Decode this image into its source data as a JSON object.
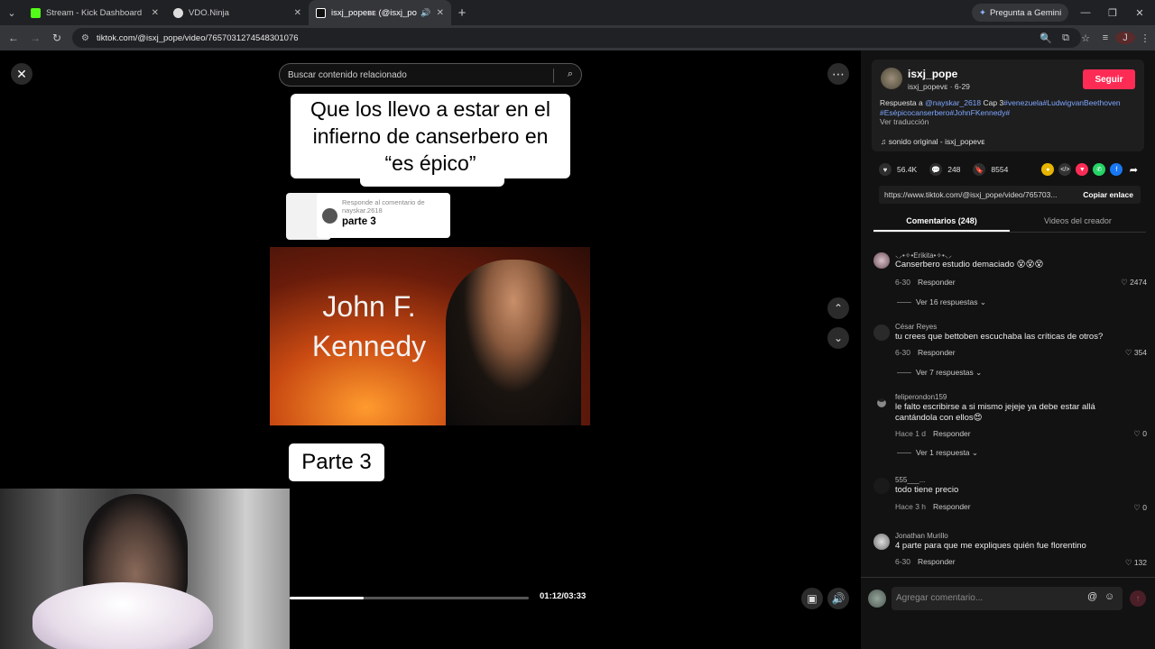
{
  "browser": {
    "tabs": [
      {
        "title": "Stream - Kick Dashboard",
        "favicon_color": "#53fc18"
      },
      {
        "title": "VDO.Ninja",
        "favicon_color": "#dddddd"
      },
      {
        "title": "isxj_popeʙᴇ (@isxj_pope) | T",
        "favicon_color": "#ffffff"
      }
    ],
    "gemini_label": "Pregunta a Gemini",
    "url": "tiktok.com/@isxj_pope/video/7657031274548301076",
    "profile_initial": "J"
  },
  "video": {
    "search_placeholder": "Buscar contenido relacionado",
    "caption": "Que los llevo a estar en el infierno de canserbero en “es épico”",
    "reply_card_header": "Responde al comentario de nayskar.2618",
    "reply_card_text": "parte 3",
    "image_text": "John F. Kennedy",
    "overlay_text": "Parte 3",
    "progress": 0.31,
    "time": "01:12/03:33"
  },
  "panel": {
    "username": "isxj_pope",
    "user_sub": "isxj_popeᴠᴇ · 6-29",
    "follow_label": "Seguir",
    "desc_prefix": "Respuesta a ",
    "desc_mention": "@nayskar_2618",
    "desc_mid": " Cap 3",
    "desc_tags1": "#venezuela#LudwigvanBeethoven",
    "desc_tags2": "#Esépicocanserbero#JohnFKennedy#",
    "see_translation": "Ver traducción",
    "sound": "sonido original - isxj_popeᴠᴇ",
    "likes": "56.4K",
    "comments_count": "248",
    "saves": "8554",
    "link": "https://www.tiktok.com/@isxj_pope/video/765703...",
    "copy_label": "Copiar enlace",
    "tab_comments": "Comentarios (248)",
    "tab_videos": "Videos del creador",
    "comments": [
      {
        "user": "⸜⸝•✧•Erikita•✧•⸜⸝",
        "text": "Canserbero estudio demaciado 😵😵😵",
        "date": "6-30",
        "reply": "Responder",
        "likes": "2474",
        "more": "Ver 16 respuestas"
      },
      {
        "user": "César Reyes",
        "text": "tu crees que bettoben escuchaba las críticas de otros?",
        "date": "6-30",
        "reply": "Responder",
        "likes": "354",
        "more": "Ver 7 respuestas"
      },
      {
        "user": "feliperondon159",
        "text": "le falto escribirse a si mismo jejeje ya debe estar allá cantándola con ellos😍",
        "date": "Hace 1 d",
        "reply": "Responder",
        "likes": "0",
        "more": "Ver 1 respuesta"
      },
      {
        "user": "555___...",
        "text": "todo tiene precio",
        "date": "Hace 3 h",
        "reply": "Responder",
        "likes": "0"
      },
      {
        "user": "Jonathan Murillo",
        "text": "4 parte para que me expliques quién fue florentino",
        "date": "6-30",
        "reply": "Responder",
        "likes": "132"
      }
    ],
    "compose_placeholder": "Agregar comentario..."
  }
}
